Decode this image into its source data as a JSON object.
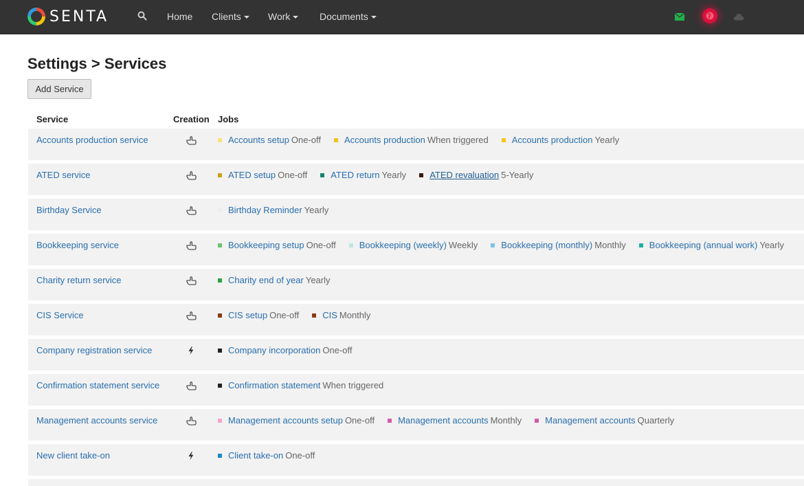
{
  "brand": {
    "name": "SENTA"
  },
  "nav": {
    "home": "Home",
    "clients": "Clients",
    "work": "Work",
    "documents": "Documents"
  },
  "colors": {
    "link": "#2a6fad",
    "navbar": "#333333",
    "alert": "#d6123d",
    "mail": "#22b04b"
  },
  "page": {
    "title": "Settings > Services",
    "add_button": "Add Service"
  },
  "table": {
    "headers": {
      "service": "Service",
      "creation": "Creation",
      "jobs": "Jobs"
    },
    "rows": [
      {
        "service": "Accounts production service",
        "creation": "hand-pointer-icon",
        "jobs": [
          {
            "name": "Accounts setup",
            "freq": "One-off",
            "color": "#f7e37a"
          },
          {
            "name": "Accounts production",
            "freq": "When triggered",
            "color": "#f5c518"
          },
          {
            "name": "Accounts production",
            "freq": "Yearly",
            "color": "#f5c518"
          }
        ]
      },
      {
        "service": "ATED service",
        "creation": "hand-pointer-icon",
        "jobs": [
          {
            "name": "ATED setup",
            "freq": "One-off",
            "color": "#c9a11b"
          },
          {
            "name": "ATED return",
            "freq": "Yearly",
            "color": "#16846f"
          },
          {
            "name": "ATED revaluation",
            "freq": "5-Yearly",
            "color": "#3a1a0e",
            "underline": true
          }
        ]
      },
      {
        "service": "Birthday Service",
        "creation": "hand-pointer-icon",
        "jobs": [
          {
            "name": "Birthday Reminder",
            "freq": "Yearly",
            "color": "#ececec"
          }
        ]
      },
      {
        "service": "Bookkeeping service",
        "creation": "hand-pointer-icon",
        "jobs": [
          {
            "name": "Bookkeeping setup",
            "freq": "One-off",
            "color": "#6cc46c"
          },
          {
            "name": "Bookkeeping (weekly)",
            "freq": "Weekly",
            "color": "#bfe6e0"
          },
          {
            "name": "Bookkeeping (monthly)",
            "freq": "Monthly",
            "color": "#7ec3e6"
          },
          {
            "name": "Bookkeeping (annual work)",
            "freq": "Yearly",
            "color": "#1fb1a6"
          }
        ]
      },
      {
        "service": "Charity return service",
        "creation": "hand-pointer-icon",
        "jobs": [
          {
            "name": "Charity end of year",
            "freq": "Yearly",
            "color": "#2ea043"
          }
        ]
      },
      {
        "service": "CIS Service",
        "creation": "hand-pointer-icon",
        "jobs": [
          {
            "name": "CIS setup",
            "freq": "One-off",
            "color": "#8a3b14"
          },
          {
            "name": "CIS",
            "freq": "Monthly",
            "color": "#8a3b14"
          }
        ]
      },
      {
        "service": "Company registration service",
        "creation": "bolt-icon",
        "jobs": [
          {
            "name": "Company incorporation",
            "freq": "One-off",
            "color": "#222222"
          }
        ]
      },
      {
        "service": "Confirmation statement service",
        "creation": "hand-pointer-icon",
        "jobs": [
          {
            "name": "Confirmation statement",
            "freq": "When triggered",
            "color": "#222222"
          }
        ]
      },
      {
        "service": "Management accounts service",
        "creation": "hand-pointer-icon",
        "jobs": [
          {
            "name": "Management accounts setup",
            "freq": "One-off",
            "color": "#f0a6c8"
          },
          {
            "name": "Management accounts",
            "freq": "Monthly",
            "color": "#d65aa8"
          },
          {
            "name": "Management accounts",
            "freq": "Quarterly",
            "color": "#d65aa8"
          }
        ]
      },
      {
        "service": "New client take-on",
        "creation": "bolt-icon",
        "jobs": [
          {
            "name": "Client take-on",
            "freq": "One-off",
            "color": "#1f87c9"
          }
        ]
      }
    ]
  }
}
